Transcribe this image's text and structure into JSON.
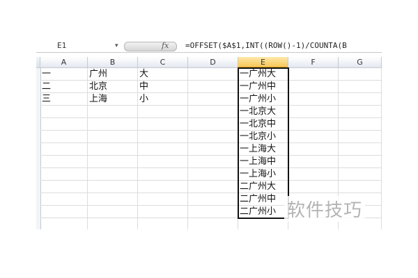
{
  "formula_bar": {
    "cell_ref": "E1",
    "fx_label": "fx",
    "formula": "=OFFSET($A$1,INT((ROW()-1)/COUNTA(B"
  },
  "columns": [
    "A",
    "B",
    "C",
    "D",
    "E",
    "F",
    "G"
  ],
  "selected_column": "E",
  "cells": {
    "A": [
      "一",
      "二",
      "三"
    ],
    "B": [
      "广州",
      "北京",
      "上海"
    ],
    "C": [
      "大",
      "中",
      "小"
    ],
    "E": [
      "一广州大",
      "一广州中",
      "一广州小",
      "一北京大",
      "一北京中",
      "一北京小",
      "一上海大",
      "一上海中",
      "一上海小",
      "二广州大",
      "二广州中",
      "二广州小"
    ]
  },
  "watermark": "软件技巧",
  "colors": {
    "selected_header": "#f7c75a",
    "grid_line": "#dcdcdc",
    "selection_border": "#111111"
  }
}
